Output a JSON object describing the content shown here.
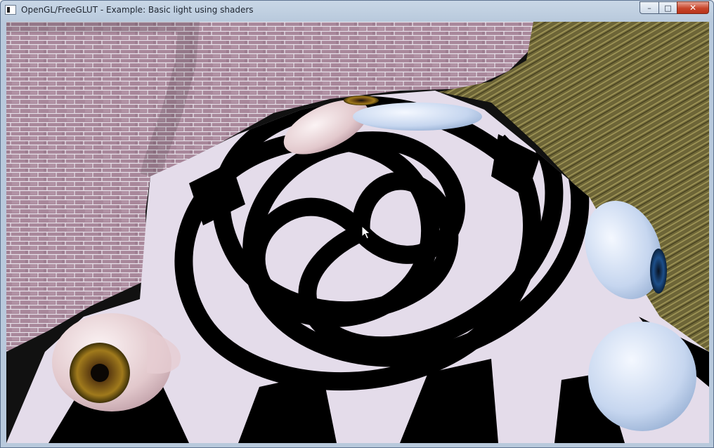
{
  "window": {
    "title": "OpenGL/FreeGLUT - Example: Basic light using shaders",
    "buttons": {
      "minimize": "–",
      "maximize": "□",
      "close": "✕"
    }
  },
  "scene": {
    "elements": [
      "brick-wall",
      "wooden-wall",
      "checkerboard-floor",
      "eyeball-spheres"
    ],
    "colors": {
      "brick": "#a8879a",
      "wood": "#6d6537",
      "floor_light": "#e4dcea",
      "floor_dark": "#000000",
      "iris_brown": "#8a6a14",
      "iris_blue": "#1d4f8a"
    }
  }
}
